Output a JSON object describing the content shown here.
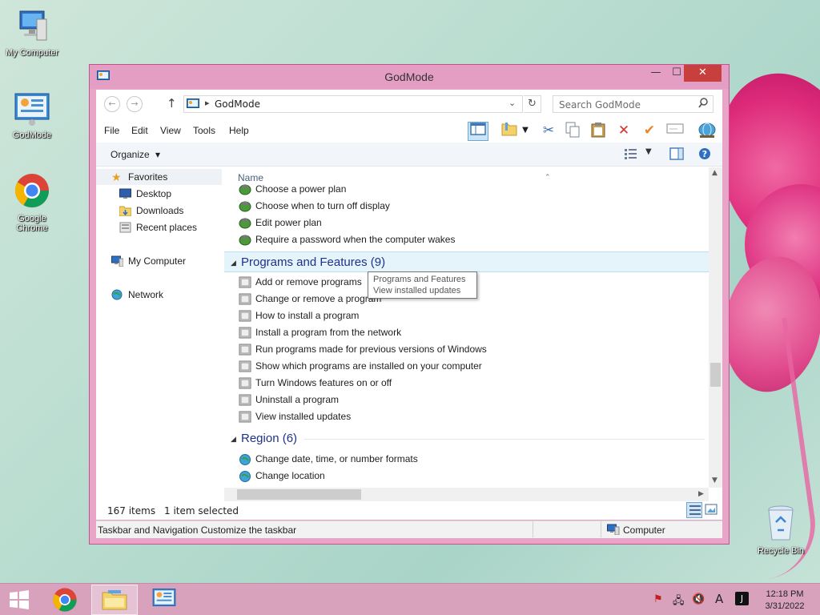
{
  "desktop": {
    "icons": [
      {
        "label": "My Computer"
      },
      {
        "label": "GodMode"
      },
      {
        "label": "Google Chrome"
      },
      {
        "label": "Recycle Bin"
      }
    ]
  },
  "window": {
    "title": "GodMode",
    "close_symbol": "✕",
    "min_symbol": "—",
    "max_symbol": "☐"
  },
  "nav": {
    "back_symbol": "←",
    "forward_symbol": "→",
    "up_symbol": "↑",
    "address": "GodMode",
    "address_chevron": "▸",
    "dropdown_symbol": "⌄",
    "refresh_symbol": "↻",
    "search_placeholder": "Search GodMode"
  },
  "menu": {
    "items": [
      "File",
      "Edit",
      "View",
      "Tools",
      "Help"
    ]
  },
  "toolbar": {
    "organize": "Organize",
    "organize_caret": "▾"
  },
  "navpane": {
    "favorites": "Favorites",
    "desktop": "Desktop",
    "downloads": "Downloads",
    "recent": "Recent places",
    "computer": "My Computer",
    "network": "Network"
  },
  "content": {
    "column_name": "Name",
    "power_items": [
      "Choose a power plan",
      "Choose when to turn off display",
      "Edit power plan",
      "Require a password when the computer wakes"
    ],
    "groups": [
      {
        "title": "Programs and Features (9)",
        "items": [
          "Add or remove programs",
          "Change or remove a program",
          "How to install a program",
          "Install a program from the network",
          "Run programs made for previous versions of Windows",
          "Show which programs are installed on your computer",
          "Turn Windows features on or off",
          "Uninstall a program",
          "View installed updates"
        ]
      },
      {
        "title": "Region (6)",
        "items": [
          "Change date, time, or number formats",
          "Change location"
        ]
      }
    ],
    "tooltip": [
      "Programs and Features",
      "View installed updates"
    ]
  },
  "details": {
    "count": "167 items",
    "selected": "1 item selected"
  },
  "status": {
    "text": "Taskbar and Navigation Customize the taskbar",
    "location": "Computer"
  },
  "taskbar": {
    "time": "12:18 PM",
    "date": "3/31/2022",
    "ime": "A"
  },
  "colors": {
    "window_frame": "#e49dc3",
    "close_button": "#c7403e",
    "group_header": "#1e3287",
    "taskbar": "#d8a2bd"
  }
}
